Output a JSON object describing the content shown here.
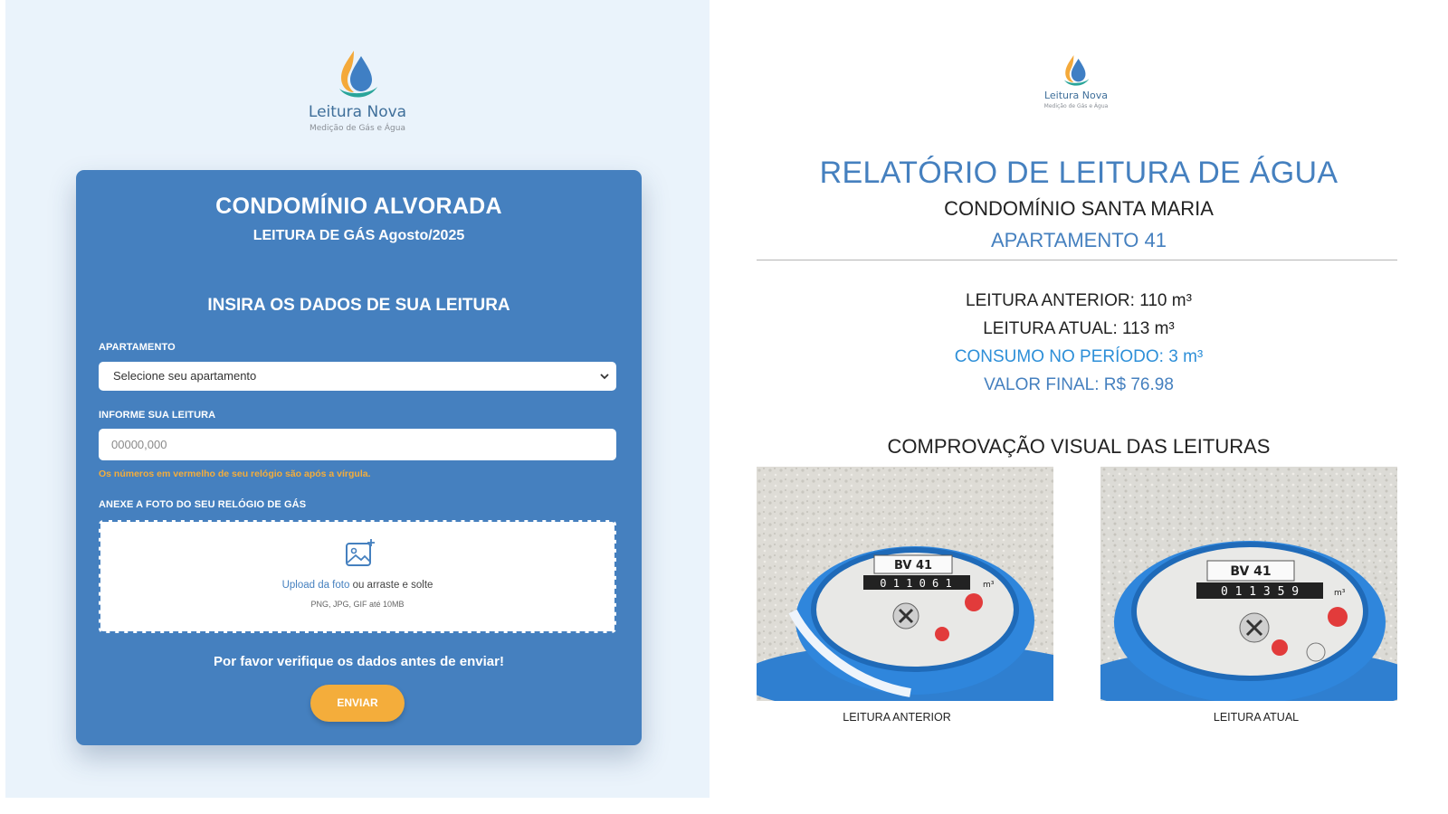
{
  "brand": {
    "name": "Leitura Nova",
    "tagline": "Medição de Gás e Água"
  },
  "form": {
    "title": "CONDOMÍNIO ALVORADA",
    "subtitle": "LEITURA DE GÁS Agosto/2025",
    "section_heading": "INSIRA OS DADOS DE SUA LEITURA",
    "apartment_label": "APARTAMENTO",
    "apartment_selected": "Selecione seu apartamento",
    "reading_label": "INFORME SUA LEITURA",
    "reading_placeholder": "00000,000",
    "reading_hint": "Os números em vermelho de seu relógio são após a vírgula.",
    "photo_label": "ANEXE A FOTO DO SEU RELÓGIO DE GÁS",
    "upload_link": "Upload da foto",
    "upload_rest": " ou arraste e solte",
    "upload_formats": "PNG, JPG, GIF até 10MB",
    "verify_text": "Por favor verifique os dados antes de enviar!",
    "submit_label": "ENVIAR"
  },
  "report": {
    "title": "RELATÓRIO DE LEITURA DE ÁGUA",
    "condominium": "CONDOMÍNIO SANTA MARIA",
    "apartment": "APARTAMENTO 41",
    "previous_reading": "LEITURA ANTERIOR: 110 m³",
    "current_reading": "LEITURA ATUAL: 113 m³",
    "consumption": "CONSUMO NO PERÍODO: 3 m³",
    "final_value": "VALOR FINAL: R$ 76.98",
    "proof_heading": "COMPROVAÇÃO VISUAL DAS LEITURAS",
    "photo_previous_caption": "LEITURA ANTERIOR",
    "photo_current_caption": "LEITURA ATUAL",
    "meter_previous": {
      "label": "BV 41",
      "digits": "0 1 1 0 6 1",
      "unit": "m³"
    },
    "meter_current": {
      "label": "BV 41",
      "digits": "0 1 1 3 5 9",
      "unit": "m³"
    }
  },
  "colors": {
    "card_blue": "#4580bf",
    "accent_orange": "#f4ad3b",
    "page_bg": "#eaf3fb",
    "consumption_blue": "#2d8fd8"
  }
}
